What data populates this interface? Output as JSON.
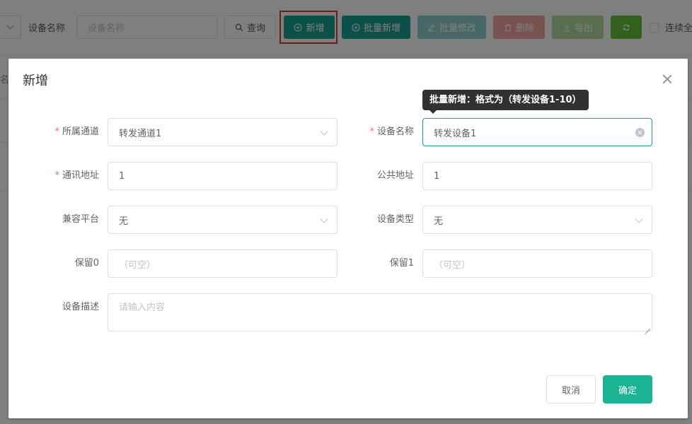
{
  "toolbar": {
    "device_name_label": "设备名称",
    "device_name_placeholder": "设备名称",
    "query_label": "查询",
    "add_label": "新增",
    "batch_add_label": "批量新增",
    "batch_edit_label": "批量修改",
    "delete_label": "删除",
    "export_label": "导出",
    "continuous_label": "连续全",
    "background_text": "名",
    "icons": {
      "query": "search-icon",
      "add": "plus-circle-icon",
      "batch_add": "plus-circle-icon",
      "batch_edit": "edit-icon",
      "delete": "trash-icon",
      "export": "download-icon",
      "refresh": "refresh-icon"
    }
  },
  "dialog": {
    "title": "新增",
    "tooltip": "批量新增：格式为（转发设备1-10）",
    "fields": {
      "channel": {
        "label": "所属通道",
        "required": true,
        "value": "转发通道1"
      },
      "device_name": {
        "label": "设备名称",
        "required": true,
        "value": "转发设备1"
      },
      "comm_address": {
        "label": "通讯地址",
        "required": true,
        "value": "1"
      },
      "public_address": {
        "label": "公共地址",
        "required": false,
        "value": "1"
      },
      "platform": {
        "label": "兼容平台",
        "required": false,
        "value": "无"
      },
      "device_type": {
        "label": "设备类型",
        "required": false,
        "value": "无"
      },
      "reserved0": {
        "label": "保留0",
        "required": false,
        "value": "",
        "placeholder": "（可空）"
      },
      "reserved1": {
        "label": "保留1",
        "required": false,
        "value": "",
        "placeholder": "（可空）"
      },
      "description": {
        "label": "设备描述",
        "required": false,
        "value": "",
        "placeholder": "请输入内容"
      }
    },
    "cancel_label": "取消",
    "confirm_label": "确定"
  },
  "colors": {
    "primary": "#17a394",
    "confirm": "#1ab394",
    "required": "#f56c6c",
    "highlight": "#e53935",
    "tooltip_bg": "#303133"
  }
}
